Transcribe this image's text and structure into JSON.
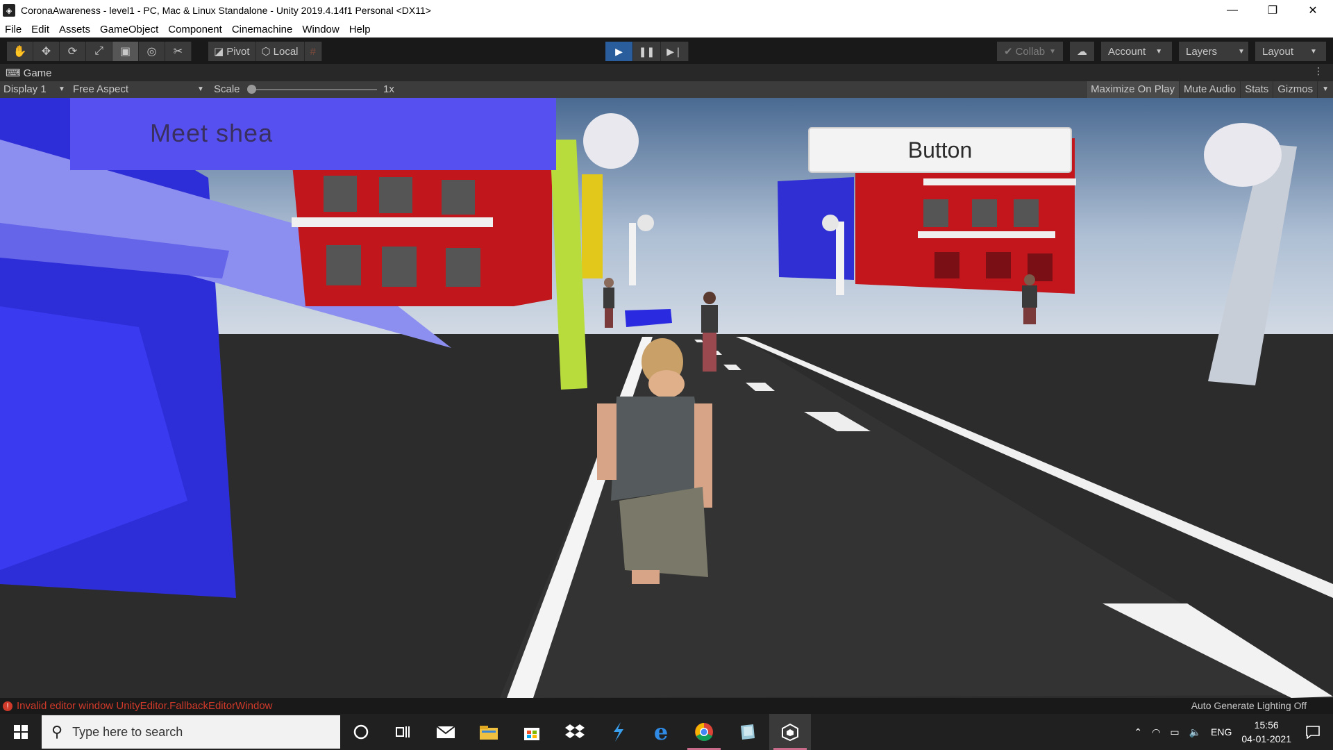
{
  "window": {
    "title": "CoronaAwareness - level1 - PC, Mac & Linux Standalone - Unity 2019.4.14f1 Personal <DX11>",
    "minimize": "—",
    "maximize": "❐",
    "close": "✕"
  },
  "menu": [
    "File",
    "Edit",
    "Assets",
    "GameObject",
    "Component",
    "Cinemachine",
    "Window",
    "Help"
  ],
  "toolbar": {
    "pivot": "Pivot",
    "local": "Local",
    "collab": "Collab",
    "account": "Account",
    "layers": "Layers",
    "layout": "Layout"
  },
  "game_tab": {
    "label": "Game"
  },
  "game_toolbar": {
    "display": "Display 1",
    "aspect": "Free Aspect",
    "scale_label": "Scale",
    "scale_value": "1x",
    "maximize_on_play": "Maximize On Play",
    "mute_audio": "Mute Audio",
    "stats": "Stats",
    "gizmos": "Gizmos"
  },
  "game_ui": {
    "panel_text": "Meet shea",
    "button_label": "Button"
  },
  "status": {
    "error": "Invalid editor window UnityEditor.FallbackEditorWindow",
    "right": "Auto Generate Lighting Off"
  },
  "taskbar": {
    "search_placeholder": "Type here to search",
    "language": "ENG",
    "time": "15:56",
    "date": "04-01-2021"
  },
  "colors": {
    "accent_play": "#2a5d9c",
    "panel_blue": "#5650f0",
    "error_red": "#d03a2a"
  }
}
